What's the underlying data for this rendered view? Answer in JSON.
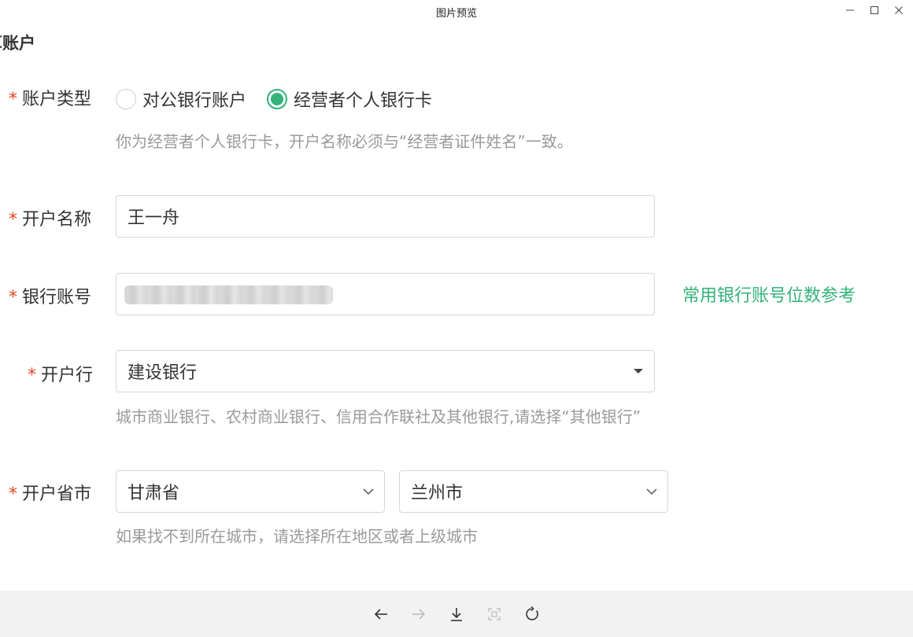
{
  "window": {
    "title": "图片预览"
  },
  "form": {
    "section_title": "算账户",
    "required_mark": "*",
    "account_type": {
      "label": "账户类型",
      "options": [
        "对公银行账户",
        "经营者个人银行卡"
      ],
      "selected": "经营者个人银行卡",
      "hint": "你为经营者个人银行卡，开户名称必须与“经营者证件姓名”一致。"
    },
    "account_name": {
      "label": "开户名称",
      "value": "王一舟"
    },
    "account_number": {
      "label": "银行账号",
      "help_link": "常用银行账号位数参考"
    },
    "bank": {
      "label": "开户行",
      "value": "建设银行",
      "hint": "城市商业银行、农村商业银行、信用合作联社及其他银行,请选择“其他银行”"
    },
    "region": {
      "label": "开户省市",
      "province": "甘肃省",
      "city": "兰州市",
      "hint": "如果找不到所在城市，请选择所在地区或者上级城市"
    }
  },
  "colors": {
    "accent": "#33b27a",
    "required": "#e8451e",
    "hint": "#9a9a9a"
  },
  "toolbar_icons": [
    "arrow-left-icon",
    "arrow-right-icon",
    "download-icon",
    "fit-screen-icon",
    "rotate-icon"
  ]
}
